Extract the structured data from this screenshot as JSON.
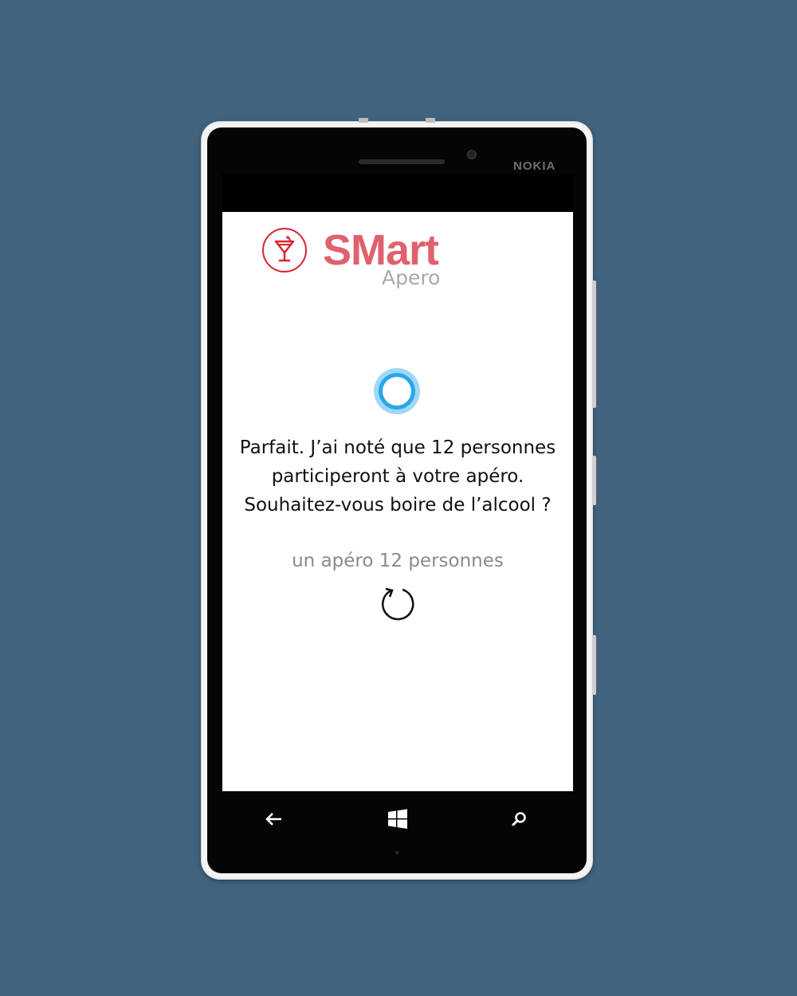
{
  "device": {
    "brand": "NOKIA"
  },
  "app": {
    "logo_title": "SMart",
    "logo_subtitle": "Apero",
    "message_lines": [
      "Parfait. J’ai noté que 12 personnes",
      "participeront à votre apéro.",
      "Souhaitez-vous boire de l’alcool ?"
    ],
    "user_query": "un apéro 12 personnes"
  },
  "nav": {
    "back_icon": "back-arrow-icon",
    "start_icon": "windows-logo-icon",
    "search_icon": "search-icon"
  },
  "colors": {
    "background": "#41637e",
    "brand_red": "#d9232f",
    "logo_pink": "#e0616e",
    "cortana_blue": "#2aa7ea"
  }
}
